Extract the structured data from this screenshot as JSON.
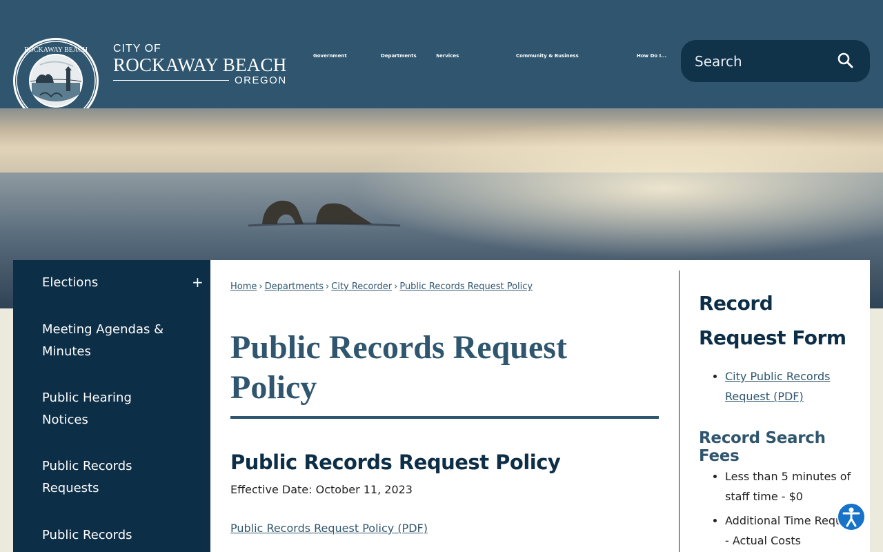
{
  "header": {
    "brand": {
      "city_of": "CITY OF",
      "name": "ROCKAWAY BEACH",
      "state": "OREGON"
    },
    "seal": {
      "top_text": "CITY OF ROCKAWAY BEACH",
      "bottom_text": "OREGON"
    },
    "nav": [
      "Government",
      "Departments",
      "Services",
      "Community & Business",
      "How Do I..."
    ],
    "search": {
      "placeholder": "Search"
    }
  },
  "sidebar": {
    "items": [
      {
        "label": "Elections",
        "expandable": true,
        "toggle": "+"
      },
      {
        "label": "Meeting Agendas & Minutes"
      },
      {
        "label": "Public Hearing Notices"
      },
      {
        "label": "Public Records Requests"
      },
      {
        "label": "Public Records"
      }
    ]
  },
  "breadcrumb": [
    "Home",
    "Departments",
    "City Recorder",
    "Public Records Request Policy"
  ],
  "main": {
    "title": "Public Records Request Policy",
    "heading": "Public Records Request Policy",
    "effective_date": "Effective Date: October 11, 2023",
    "pdf_link": "Public Records Request Policy (PDF)"
  },
  "aside": {
    "form_title": "Record Request Form",
    "form_link": "City Public Records Request (PDF)",
    "fees_title": "Record Search Fees",
    "fees": [
      "Less than 5 minutes of staff time - $0",
      "Additional Time Required - Actual Costs"
    ]
  },
  "colors": {
    "header": "#2f566e",
    "navy": "#0d2e47",
    "accent": "#2f566e",
    "page_bg": "#ece9dd",
    "accessibility": "#1673c8"
  },
  "icons": {
    "search": "search-icon",
    "accessibility": "accessibility-icon",
    "toggle": "plus-icon"
  }
}
